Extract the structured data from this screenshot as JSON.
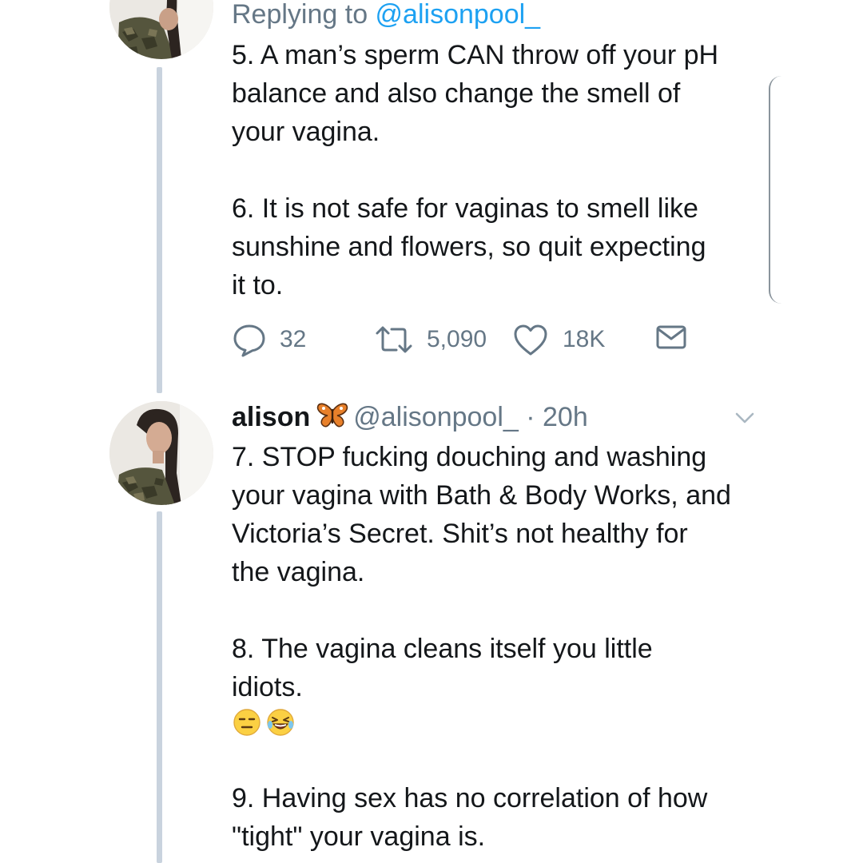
{
  "tweet1": {
    "replying_prefix": "Replying to ",
    "replying_handle": "@alisonpool_",
    "text": "5. A man’s sperm CAN throw off your pH\nbalance and also change the smell of\nyour vagina.\n\n6. It is not safe for vaginas to smell like\nsunshine and flowers, so quit expecting\nit to.",
    "actions": {
      "replies": "32",
      "retweets": "5,090",
      "likes": "18K",
      "reply_icon": "speech-bubble-icon",
      "retweet_icon": "retweet-icon",
      "like_icon": "heart-icon",
      "dm_icon": "envelope-icon"
    }
  },
  "tweet2": {
    "name": "alison",
    "name_emoji": "butterfly",
    "handle": "@alisonpool_",
    "time": " · 20h",
    "text_a": "7. STOP fucking douching and washing\nyour vagina with Bath & Body Works, and\nVictoria’s Secret. Shit’s not healthy for\nthe vagina.\n\n8. The vagina cleans itself you little\nidiots.",
    "emojis": [
      "expressionless-face",
      "laughing-face"
    ],
    "text_b": "9. Having sex has no correlation of how\n\"tight\" your vagina is."
  },
  "colors": {
    "text": "#14171a",
    "muted": "#657786",
    "link": "#1da1f2",
    "thread_line": "#c9d3de"
  }
}
